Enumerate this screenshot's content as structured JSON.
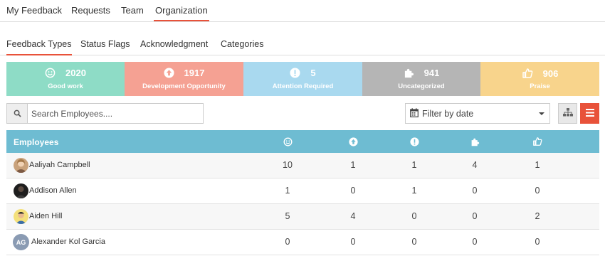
{
  "top_nav": {
    "tabs": [
      {
        "label": "My Feedback"
      },
      {
        "label": "Requests"
      },
      {
        "label": "Team"
      },
      {
        "label": "Organization",
        "active": true
      }
    ]
  },
  "sub_nav": {
    "tabs": [
      {
        "label": "Feedback Types",
        "active": true
      },
      {
        "label": "Status Flags"
      },
      {
        "label": "Acknowledgment"
      },
      {
        "label": "Categories"
      }
    ]
  },
  "stats": [
    {
      "value": "2020",
      "label": "Good work",
      "icon": "smile-icon",
      "color": "#8edcc6"
    },
    {
      "value": "1917",
      "label": "Development Opportunity",
      "icon": "arrow-up-circle-icon",
      "color": "#f5a193"
    },
    {
      "value": "5",
      "label": "Attention Required",
      "icon": "exclamation-circle-icon",
      "color": "#a9d9ef"
    },
    {
      "value": "941",
      "label": "Uncategorized",
      "icon": "puzzle-icon",
      "color": "#b5b5b5"
    },
    {
      "value": "906",
      "label": "Praise",
      "icon": "thumbs-up-icon",
      "color": "#f8d48c"
    }
  ],
  "search": {
    "placeholder": "Search Employees...."
  },
  "date_filter": {
    "label": "Filter by date"
  },
  "table": {
    "header": "Employees",
    "column_icons": [
      "smile-icon",
      "arrow-up-circle-icon",
      "exclamation-circle-icon",
      "puzzle-icon",
      "thumbs-up-icon"
    ],
    "rows": [
      {
        "name": "Aaliyah Campbell",
        "values": [
          "10",
          "1",
          "1",
          "4",
          "1"
        ]
      },
      {
        "name": "Addison Allen",
        "values": [
          "1",
          "0",
          "1",
          "0",
          "0"
        ]
      },
      {
        "name": "Aiden Hill",
        "values": [
          "5",
          "4",
          "0",
          "0",
          "2"
        ]
      },
      {
        "name": "Alexander Kol Garcia",
        "initials": "AG",
        "values": [
          "0",
          "0",
          "0",
          "0",
          "0"
        ]
      }
    ]
  },
  "colors": {
    "accent": "#e8523a",
    "table_header": "#6ebcd2"
  }
}
